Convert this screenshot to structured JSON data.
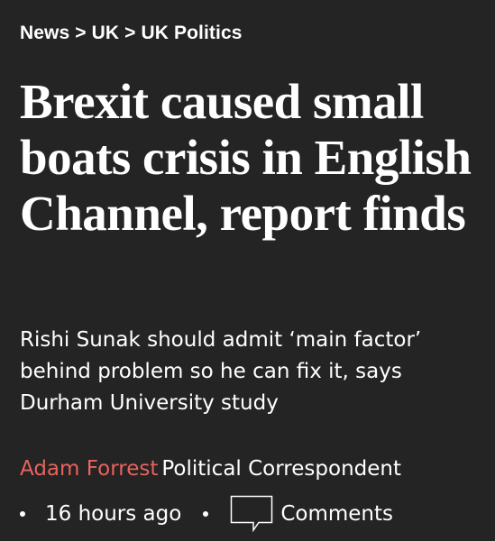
{
  "breadcrumb": {
    "items": [
      "News",
      "UK",
      "UK Politics"
    ],
    "separator": ">"
  },
  "article": {
    "headline": "Brexit caused small boats crisis in English Channel, report finds",
    "standfirst": "Rishi Sunak should admit ‘main factor’ behind problem so he can fix it, says Durham University study",
    "author": "Adam Forrest",
    "author_role": "Political Correspondent",
    "published": "16 hours ago",
    "comments_label": "Comments"
  },
  "colors": {
    "background": "#242424",
    "text": "#ffffff",
    "author_accent": "#e8635c"
  },
  "icons": {
    "comments": "speech-bubble-icon"
  }
}
